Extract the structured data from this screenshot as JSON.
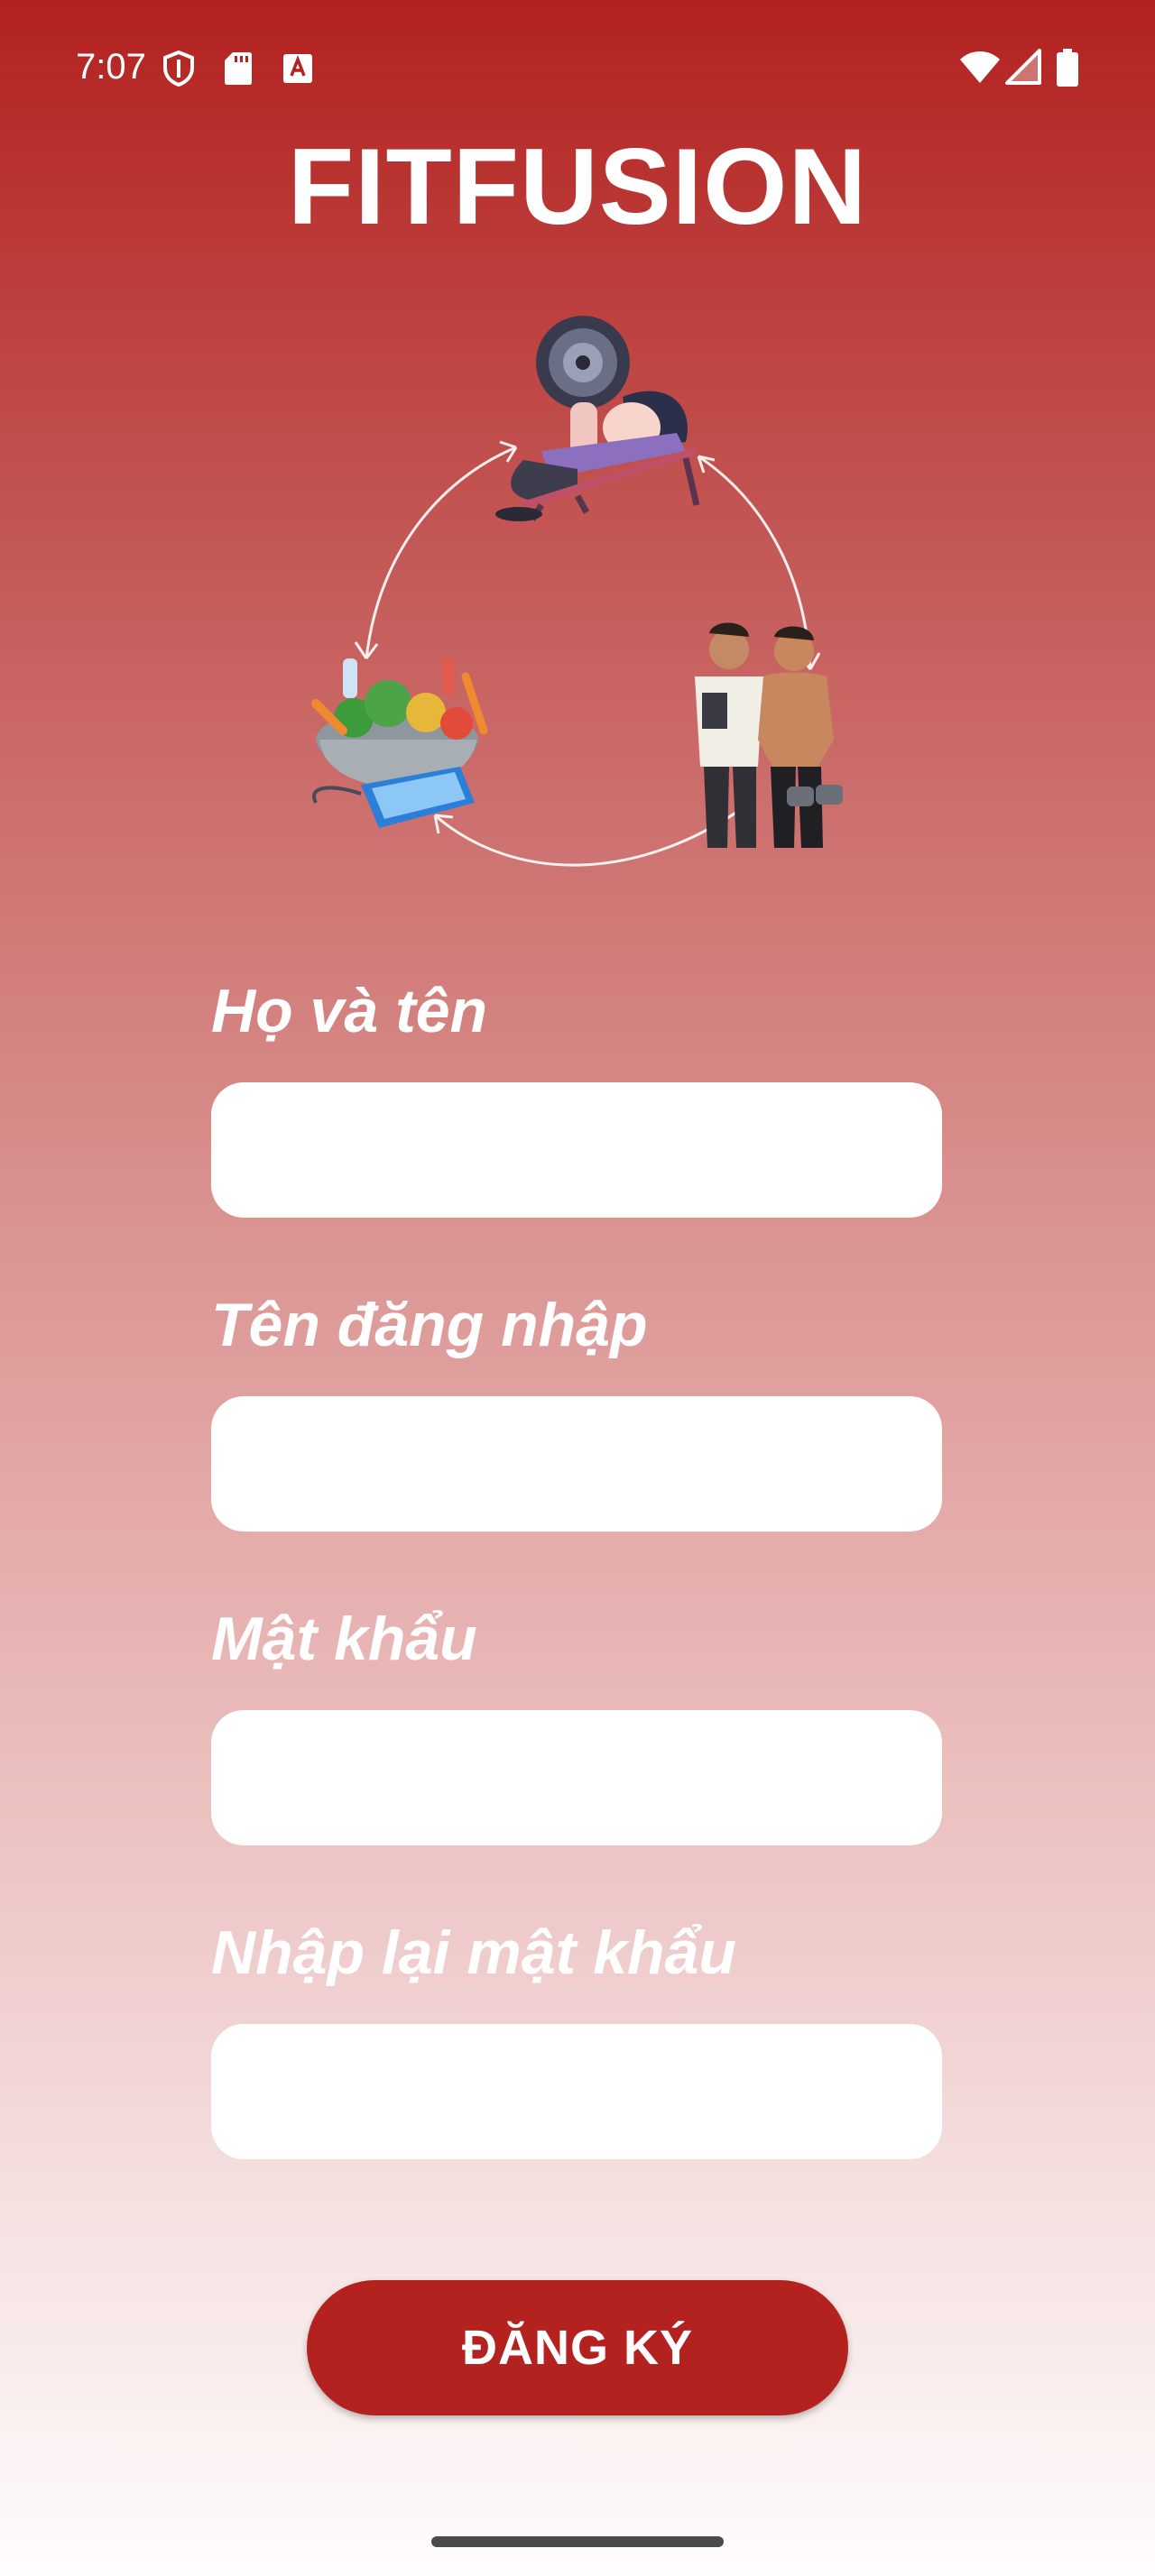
{
  "status_bar": {
    "time": "7:07",
    "left_icons": [
      "shield-icon",
      "sd-card-icon",
      "keyboard-a-icon"
    ],
    "right_icons": [
      "wifi-icon",
      "signal-icon",
      "battery-icon"
    ]
  },
  "app": {
    "title": "FITFUSION",
    "title_color": "#ffffff"
  },
  "illustration": {
    "items": [
      "weightlifter-icon",
      "trainer-and-athlete-icon",
      "healthy-food-bowl-icon"
    ]
  },
  "form": {
    "full_name_label": "Họ và tên",
    "full_name_value": "",
    "username_label": "Tên đăng nhập",
    "username_value": "",
    "password_label": "Mật khẩu",
    "password_value": "",
    "confirm_password_label": "Nhập lại mật khẩu",
    "confirm_password_value": "",
    "submit_label": "ĐĂNG KÝ"
  },
  "colors": {
    "accent": "#b3221f",
    "background_top": "#b3221f",
    "background_bottom": "#fefcfc",
    "input_background": "#ffffff"
  }
}
